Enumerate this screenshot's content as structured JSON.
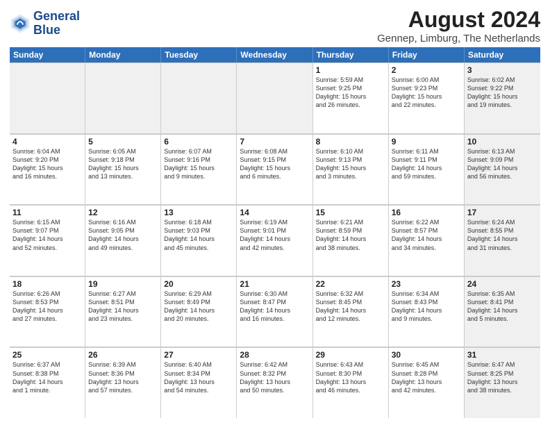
{
  "header": {
    "logo_general": "General",
    "logo_blue": "Blue",
    "title": "August 2024",
    "subtitle": "Gennep, Limburg, The Netherlands"
  },
  "calendar": {
    "days": [
      "Sunday",
      "Monday",
      "Tuesday",
      "Wednesday",
      "Thursday",
      "Friday",
      "Saturday"
    ],
    "weeks": [
      [
        {
          "day": "",
          "text": "",
          "shaded": true
        },
        {
          "day": "",
          "text": "",
          "shaded": true
        },
        {
          "day": "",
          "text": "",
          "shaded": true
        },
        {
          "day": "",
          "text": "",
          "shaded": true
        },
        {
          "day": "1",
          "text": "Sunrise: 5:59 AM\nSunset: 9:25 PM\nDaylight: 15 hours\nand 26 minutes.",
          "shaded": false
        },
        {
          "day": "2",
          "text": "Sunrise: 6:00 AM\nSunset: 9:23 PM\nDaylight: 15 hours\nand 22 minutes.",
          "shaded": false
        },
        {
          "day": "3",
          "text": "Sunrise: 6:02 AM\nSunset: 9:22 PM\nDaylight: 15 hours\nand 19 minutes.",
          "shaded": true
        }
      ],
      [
        {
          "day": "4",
          "text": "Sunrise: 6:04 AM\nSunset: 9:20 PM\nDaylight: 15 hours\nand 16 minutes.",
          "shaded": false
        },
        {
          "day": "5",
          "text": "Sunrise: 6:05 AM\nSunset: 9:18 PM\nDaylight: 15 hours\nand 13 minutes.",
          "shaded": false
        },
        {
          "day": "6",
          "text": "Sunrise: 6:07 AM\nSunset: 9:16 PM\nDaylight: 15 hours\nand 9 minutes.",
          "shaded": false
        },
        {
          "day": "7",
          "text": "Sunrise: 6:08 AM\nSunset: 9:15 PM\nDaylight: 15 hours\nand 6 minutes.",
          "shaded": false
        },
        {
          "day": "8",
          "text": "Sunrise: 6:10 AM\nSunset: 9:13 PM\nDaylight: 15 hours\nand 3 minutes.",
          "shaded": false
        },
        {
          "day": "9",
          "text": "Sunrise: 6:11 AM\nSunset: 9:11 PM\nDaylight: 14 hours\nand 59 minutes.",
          "shaded": false
        },
        {
          "day": "10",
          "text": "Sunrise: 6:13 AM\nSunset: 9:09 PM\nDaylight: 14 hours\nand 56 minutes.",
          "shaded": true
        }
      ],
      [
        {
          "day": "11",
          "text": "Sunrise: 6:15 AM\nSunset: 9:07 PM\nDaylight: 14 hours\nand 52 minutes.",
          "shaded": false
        },
        {
          "day": "12",
          "text": "Sunrise: 6:16 AM\nSunset: 9:05 PM\nDaylight: 14 hours\nand 49 minutes.",
          "shaded": false
        },
        {
          "day": "13",
          "text": "Sunrise: 6:18 AM\nSunset: 9:03 PM\nDaylight: 14 hours\nand 45 minutes.",
          "shaded": false
        },
        {
          "day": "14",
          "text": "Sunrise: 6:19 AM\nSunset: 9:01 PM\nDaylight: 14 hours\nand 42 minutes.",
          "shaded": false
        },
        {
          "day": "15",
          "text": "Sunrise: 6:21 AM\nSunset: 8:59 PM\nDaylight: 14 hours\nand 38 minutes.",
          "shaded": false
        },
        {
          "day": "16",
          "text": "Sunrise: 6:22 AM\nSunset: 8:57 PM\nDaylight: 14 hours\nand 34 minutes.",
          "shaded": false
        },
        {
          "day": "17",
          "text": "Sunrise: 6:24 AM\nSunset: 8:55 PM\nDaylight: 14 hours\nand 31 minutes.",
          "shaded": true
        }
      ],
      [
        {
          "day": "18",
          "text": "Sunrise: 6:26 AM\nSunset: 8:53 PM\nDaylight: 14 hours\nand 27 minutes.",
          "shaded": false
        },
        {
          "day": "19",
          "text": "Sunrise: 6:27 AM\nSunset: 8:51 PM\nDaylight: 14 hours\nand 23 minutes.",
          "shaded": false
        },
        {
          "day": "20",
          "text": "Sunrise: 6:29 AM\nSunset: 8:49 PM\nDaylight: 14 hours\nand 20 minutes.",
          "shaded": false
        },
        {
          "day": "21",
          "text": "Sunrise: 6:30 AM\nSunset: 8:47 PM\nDaylight: 14 hours\nand 16 minutes.",
          "shaded": false
        },
        {
          "day": "22",
          "text": "Sunrise: 6:32 AM\nSunset: 8:45 PM\nDaylight: 14 hours\nand 12 minutes.",
          "shaded": false
        },
        {
          "day": "23",
          "text": "Sunrise: 6:34 AM\nSunset: 8:43 PM\nDaylight: 14 hours\nand 9 minutes.",
          "shaded": false
        },
        {
          "day": "24",
          "text": "Sunrise: 6:35 AM\nSunset: 8:41 PM\nDaylight: 14 hours\nand 5 minutes.",
          "shaded": true
        }
      ],
      [
        {
          "day": "25",
          "text": "Sunrise: 6:37 AM\nSunset: 8:38 PM\nDaylight: 14 hours\nand 1 minute.",
          "shaded": false
        },
        {
          "day": "26",
          "text": "Sunrise: 6:39 AM\nSunset: 8:36 PM\nDaylight: 13 hours\nand 57 minutes.",
          "shaded": false
        },
        {
          "day": "27",
          "text": "Sunrise: 6:40 AM\nSunset: 8:34 PM\nDaylight: 13 hours\nand 54 minutes.",
          "shaded": false
        },
        {
          "day": "28",
          "text": "Sunrise: 6:42 AM\nSunset: 8:32 PM\nDaylight: 13 hours\nand 50 minutes.",
          "shaded": false
        },
        {
          "day": "29",
          "text": "Sunrise: 6:43 AM\nSunset: 8:30 PM\nDaylight: 13 hours\nand 46 minutes.",
          "shaded": false
        },
        {
          "day": "30",
          "text": "Sunrise: 6:45 AM\nSunset: 8:28 PM\nDaylight: 13 hours\nand 42 minutes.",
          "shaded": false
        },
        {
          "day": "31",
          "text": "Sunrise: 6:47 AM\nSunset: 8:25 PM\nDaylight: 13 hours\nand 38 minutes.",
          "shaded": true
        }
      ]
    ]
  }
}
